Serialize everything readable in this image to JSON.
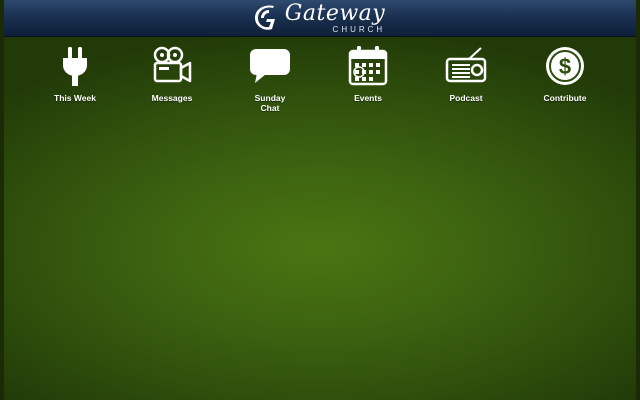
{
  "header": {
    "logo_name": "Gateway",
    "logo_sub": "CHURCH",
    "logo_icon": "gateway-logo-mark"
  },
  "nav": {
    "items": [
      {
        "label": "This Week",
        "icon": "plug-icon"
      },
      {
        "label": "Messages",
        "icon": "video-camera-icon"
      },
      {
        "label": "Sunday\nChat",
        "icon": "chat-bubble-icon"
      },
      {
        "label": "Events",
        "icon": "calendar-icon"
      },
      {
        "label": "Podcast",
        "icon": "radio-icon"
      },
      {
        "label": "Contribute",
        "icon": "dollar-coin-icon"
      }
    ]
  },
  "colors": {
    "header_top": "#2d4a6e",
    "header_bottom": "#0e1f37",
    "background_center": "#4a7512",
    "background_edge": "#223a08",
    "text": "#ffffff"
  }
}
